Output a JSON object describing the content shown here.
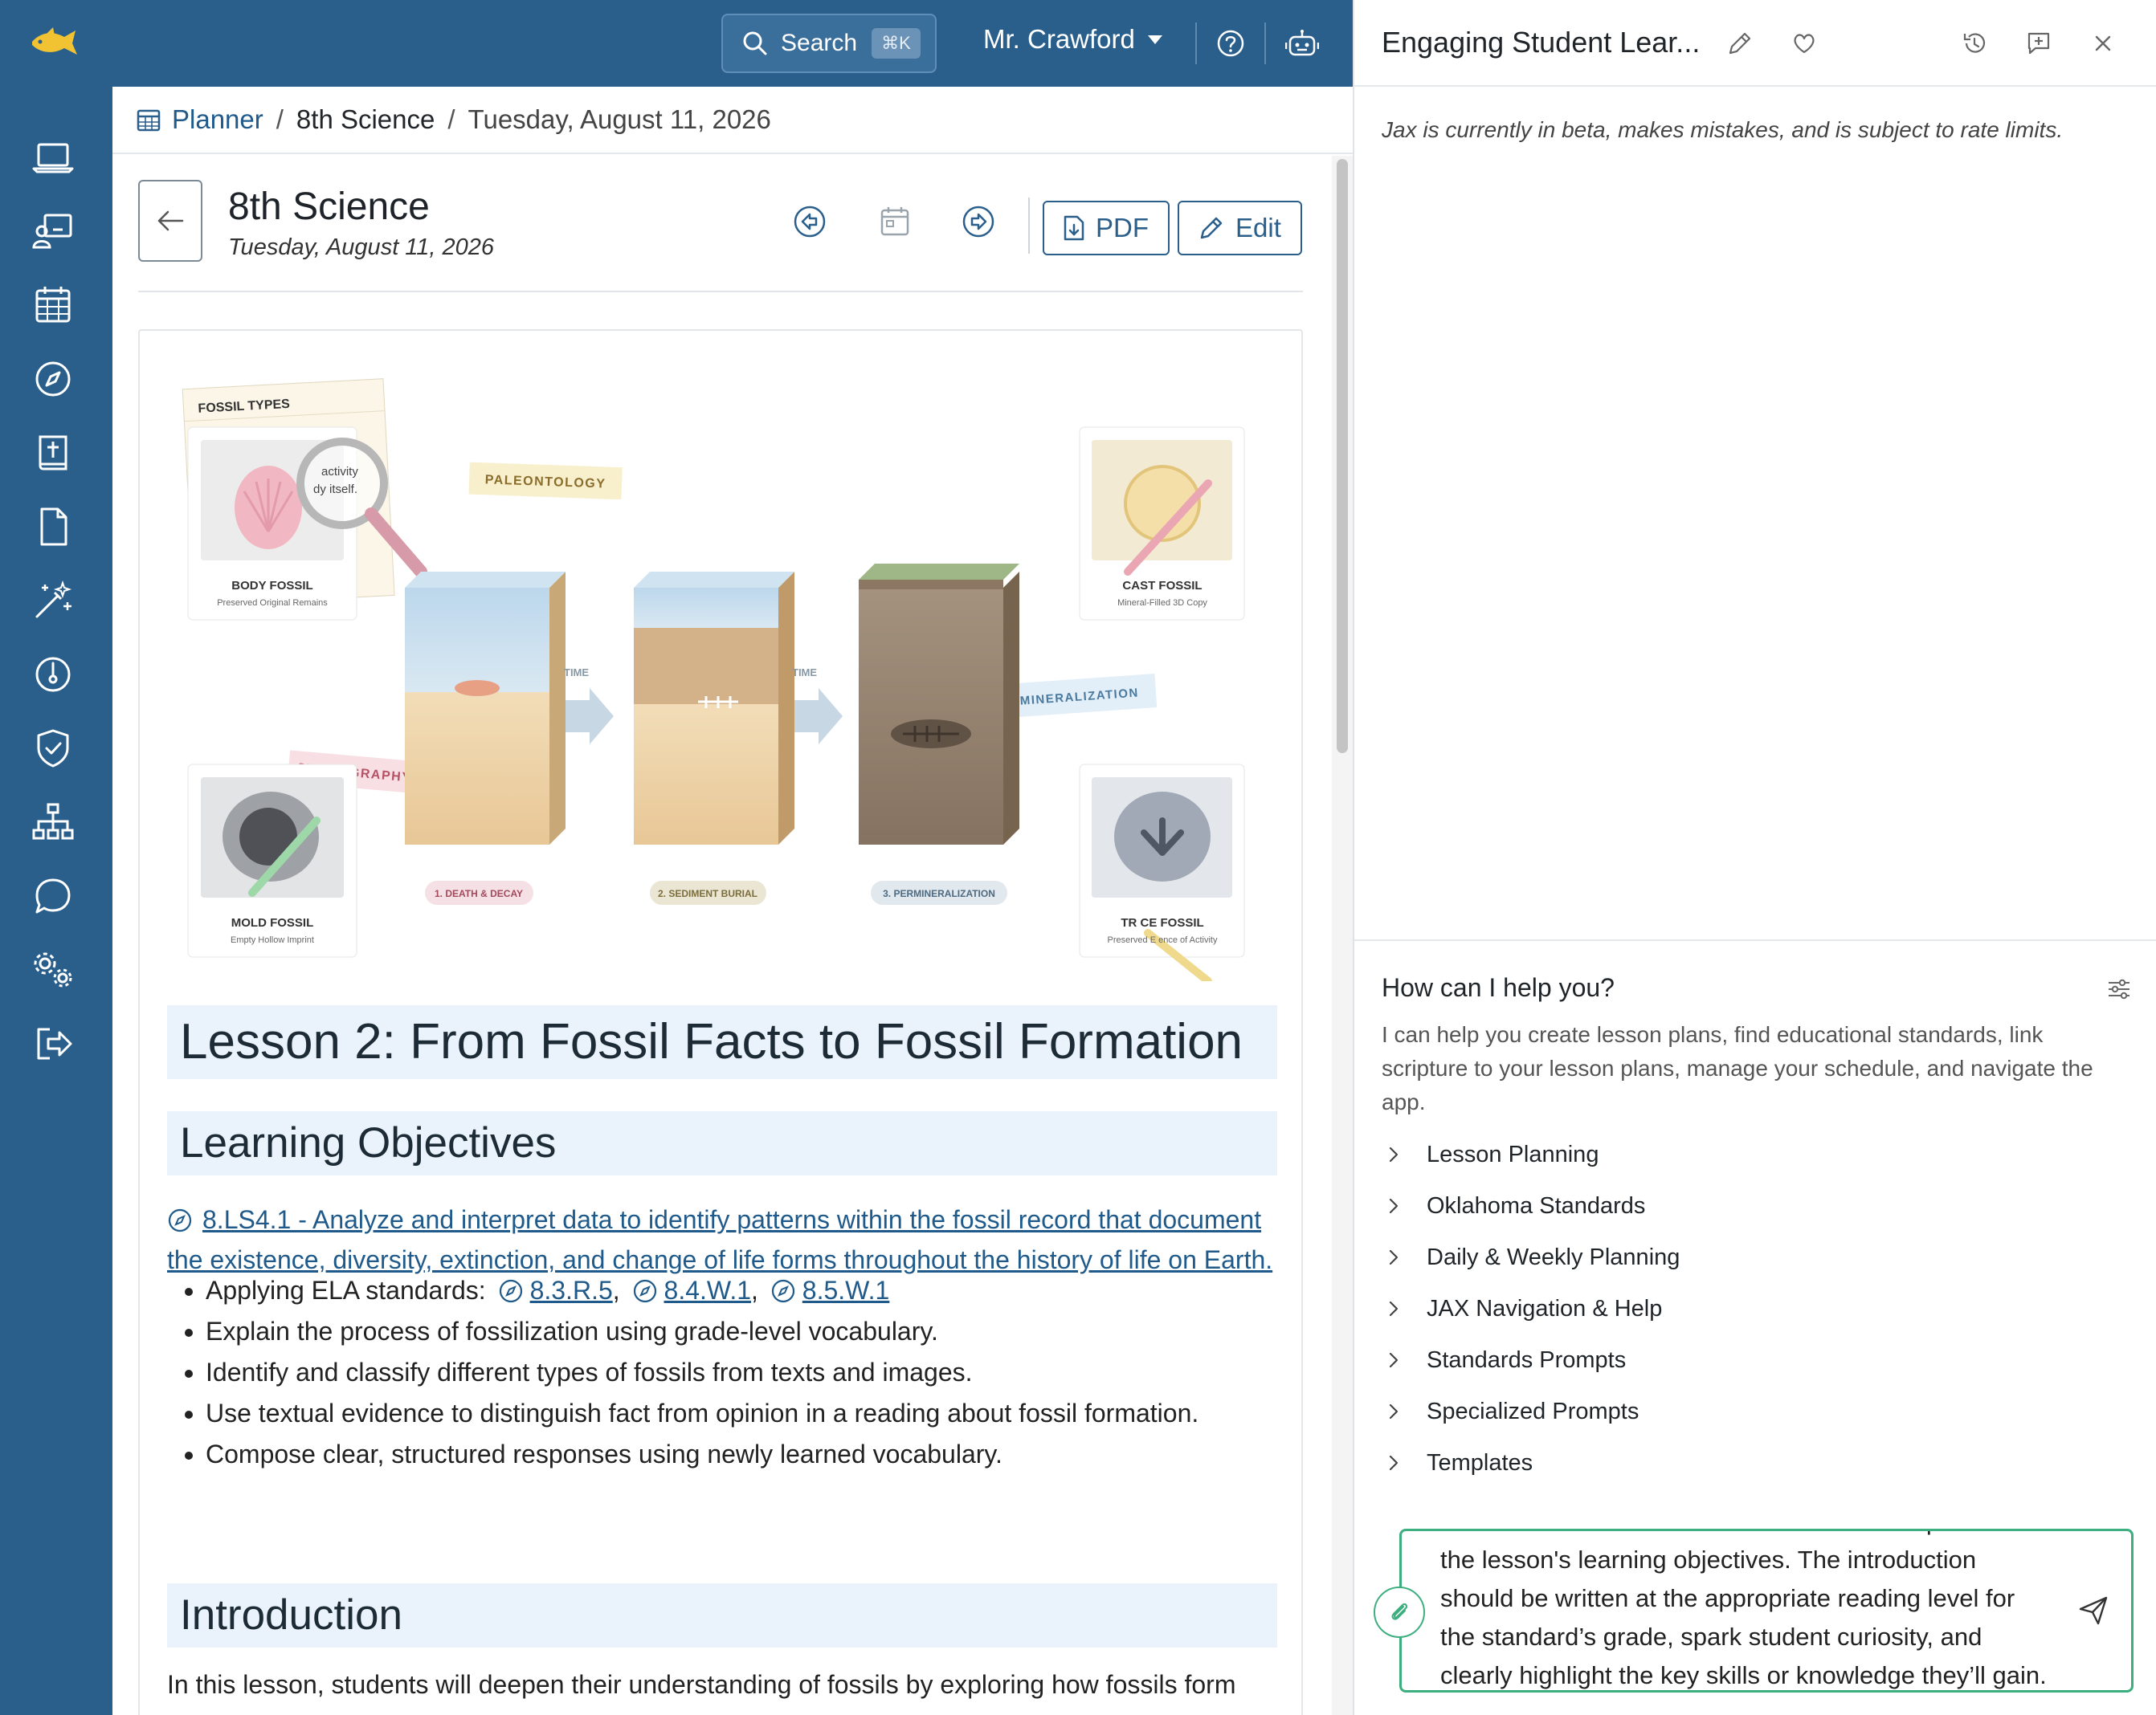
{
  "topbar": {
    "search_label": "Search",
    "search_shortcut": "⌘K",
    "user_name": "Mr. Crawford"
  },
  "sidebar": {
    "icons": [
      "laptop-icon",
      "teacher-board-icon",
      "calendar-icon",
      "compass-icon",
      "bible-icon",
      "document-icon",
      "magic-wand-icon",
      "gauge-icon",
      "shield-check-icon",
      "sitemap-icon",
      "chat-icon",
      "gears-icon",
      "logout-icon"
    ]
  },
  "breadcrumb": {
    "root": "Planner",
    "sep1": "/",
    "course": "8th Science",
    "sep2": "/",
    "date": "Tuesday, August 11, 2026"
  },
  "header": {
    "title": "8th Science",
    "subtitle": "Tuesday, August 11, 2026",
    "pdf_label": "PDF",
    "edit_label": "Edit"
  },
  "figure": {
    "fossil_types_title": "FOSSIL TYPES",
    "lens_text1": "activity",
    "lens_text2": "dy itself.",
    "paleontology": "PALEONTOLOGY",
    "stratigraphy": "STRATIGRAPHY",
    "permineralization_tag": "PERMINERALIZATION",
    "time1": "TIME",
    "time2": "TIME",
    "body_fossil": "BODY FOSSIL",
    "body_fossil_sub": "Preserved Original Remains",
    "cast_fossil": "CAST FOSSIL",
    "cast_fossil_sub": "Mineral-Filled 3D Copy",
    "mold_fossil": "MOLD FOSSIL",
    "mold_fossil_sub": "Empty Hollow Imprint",
    "trace_fossil": "TR CE FOSSIL",
    "trace_fossil_sub": "Preserved E ence of Activity",
    "step1": "1. DEATH & DECAY",
    "step2": "2. SEDIMENT BURIAL",
    "step3": "3. PERMINERALIZATION"
  },
  "lesson": {
    "title": "Lesson 2: From Fossil Facts to Fossil Formation",
    "objectives_heading": "Learning Objectives",
    "objective_link": "8.LS4.1 - Analyze and interpret data to identify patterns within the fossil record that document the existence, diversity, extinction, and change of life forms throughout the history of life on Earth.",
    "ela_prefix": "Applying ELA standards:",
    "ela_std1": "8.3.R.5",
    "ela_std2": "8.4.W.1",
    "ela_std3": "8.5.W.1",
    "comma": ",",
    "bullet2": "Explain the process of fossilization using grade-level vocabulary.",
    "bullet3": "Identify and classify different types of fossils from texts and images.",
    "bullet4": "Use textual evidence to distinguish fact from opinion in a reading about fossil formation.",
    "bullet5": "Compose clear, structured responses using newly learned vocabulary.",
    "intro_heading": "Introduction",
    "intro_text": "In this lesson, students will deepen their understanding of fossils by exploring how fossils form"
  },
  "panel": {
    "title": "Engaging Student Lear...",
    "beta_note": "Jax is currently in beta, makes mistakes, and is subject to rate limits.",
    "help_title": "How can I help you?",
    "help_desc": "I can help you create lesson plans, find educational standards, link scripture to your lesson plans, manage your schedule, and navigate the app.",
    "accordion": [
      "Lesson Planning",
      "Oklahoma Standards",
      "Daily & Weekly Planning",
      "JAX Navigation & Help",
      "Standards Prompts",
      "Specialized Prompts",
      "Templates"
    ],
    "chat_value": "lesson introduction that hooks students and previews the lesson's learning objectives. The introduction should be written at the appropriate reading level for the standard’s grade, spark student curiosity, and clearly highlight the key skills or knowledge they’ll gain. Do not format the text."
  },
  "colors": {
    "brand": "#2a5f8c",
    "accent_green": "#3cae7f",
    "heading_bg": "#eaf3fb",
    "link": "#1f5a8a"
  }
}
